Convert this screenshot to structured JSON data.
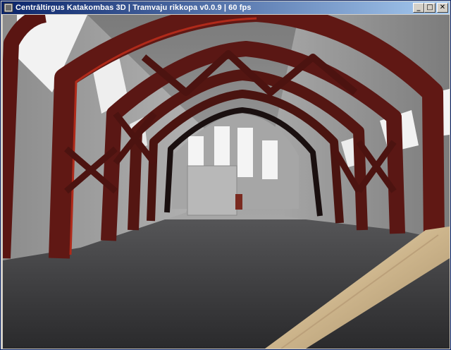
{
  "window": {
    "title": "Centrāltirgus Katakombas 3D | Tramvaju rikkopa v0.0.9 | 60 fps",
    "title_icon": "app-icon",
    "controls": [
      {
        "name": "minimize",
        "glyph": "_"
      },
      {
        "name": "maximize",
        "glyph": "□"
      },
      {
        "name": "close",
        "glyph": "✕"
      }
    ]
  },
  "scene": {
    "kind": "first-person 3D view of an attic hall with wooden roof trusses",
    "held_item": "wooden stick"
  },
  "colors": {
    "titlebar_start": "#0a246a",
    "titlebar_end": "#a6caf0",
    "truss": "#5a1512",
    "truss_edge": "#b02a1a",
    "floor": "#3e3e40",
    "wall": "#9a9a9a",
    "skylight": "#f2f2f2",
    "stick": "#d8c4a0"
  }
}
